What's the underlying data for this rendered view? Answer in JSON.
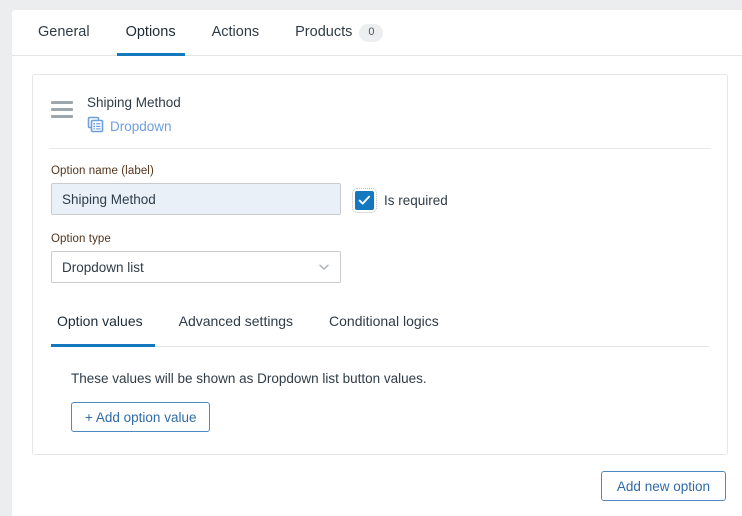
{
  "tabs": [
    {
      "label": "General",
      "active": false,
      "badge": null
    },
    {
      "label": "Options",
      "active": true,
      "badge": null
    },
    {
      "label": "Actions",
      "active": false,
      "badge": null
    },
    {
      "label": "Products",
      "active": false,
      "badge": "0"
    }
  ],
  "option_card": {
    "title": "Shiping Method",
    "type_link": "Dropdown",
    "name_field": {
      "label": "Option name (label)",
      "value": "Shiping Method"
    },
    "required_checkbox": {
      "label": "Is required",
      "checked": true
    },
    "type_field": {
      "label": "Option type",
      "value": "Dropdown list"
    },
    "inner_tabs": [
      {
        "label": "Option values",
        "active": true
      },
      {
        "label": "Advanced settings",
        "active": false
      },
      {
        "label": "Conditional logics",
        "active": false
      }
    ],
    "panel": {
      "description": "These values will be shown as Dropdown list button values.",
      "add_value_button": "+ Add option value"
    }
  },
  "footer": {
    "add_option_button": "Add new option"
  },
  "colors": {
    "accent": "#1378be",
    "link": "#6f9fe0",
    "button_border": "#4f89c4",
    "button_text": "#2f6ba8",
    "input_focus_bg": "#e9f0f8",
    "label_text": "#51341c",
    "page_bg": "#ecedee"
  }
}
